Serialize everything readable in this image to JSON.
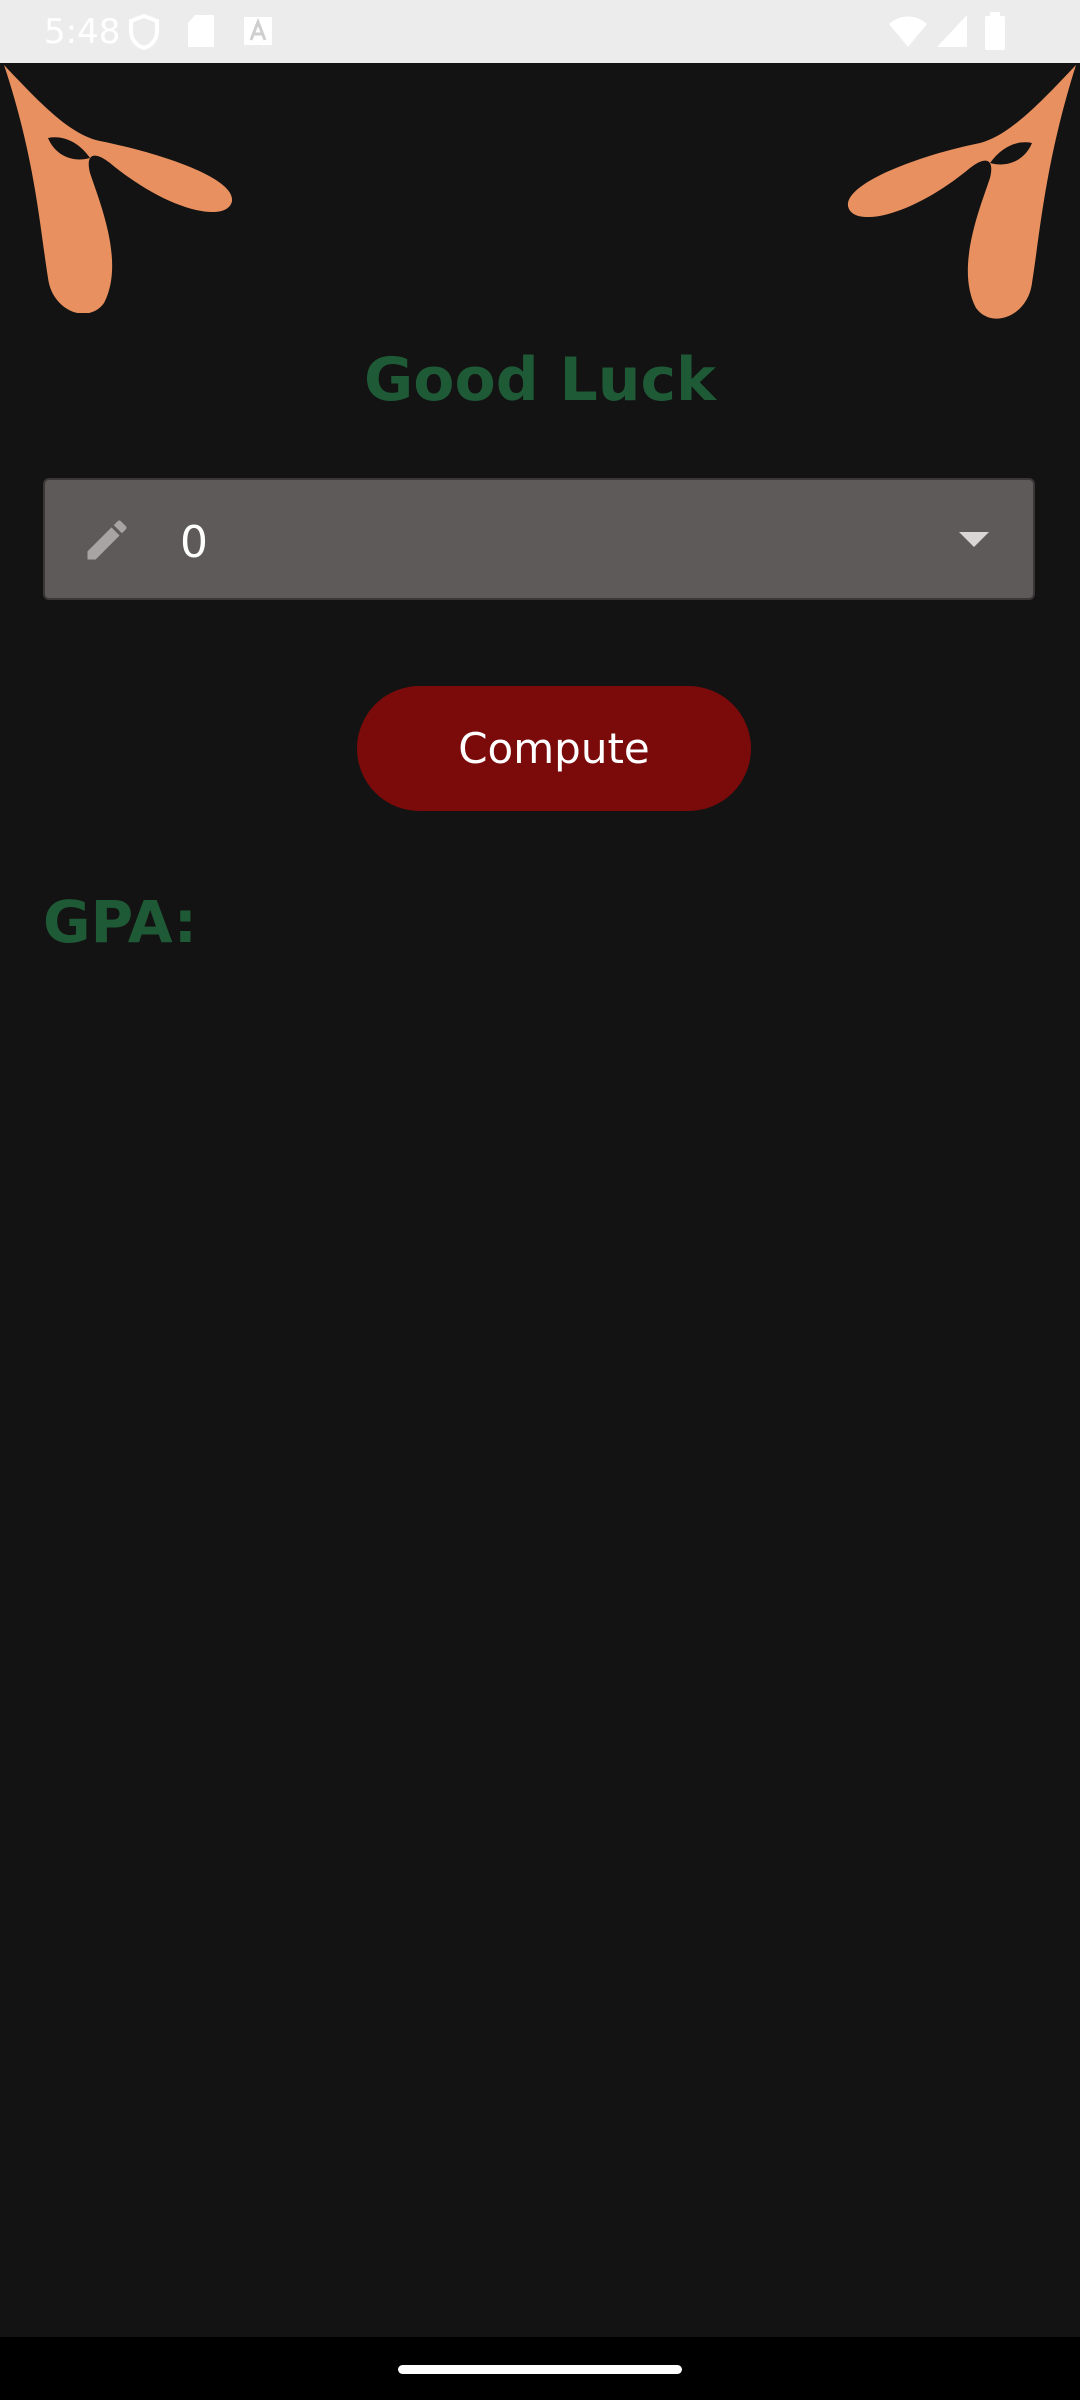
{
  "status_bar": {
    "time": "5:48",
    "left_icons": [
      "shield-icon",
      "sd-card-icon",
      "keyboard-a-icon"
    ],
    "right_icons": [
      "wifi-icon",
      "signal-icon",
      "battery-icon"
    ]
  },
  "app": {
    "title": "Good Luck",
    "dropdown": {
      "value": "0",
      "icon": "pencil-icon",
      "caret": "chevron-down-icon"
    },
    "compute_label": "Compute",
    "result_label": "GPA:"
  },
  "colors": {
    "background": "#131313",
    "title_green": "#1f5a36",
    "button_red": "#7b0b0b",
    "dropdown_gray": "#5e5a59",
    "petal_orange": "#e8905f"
  }
}
